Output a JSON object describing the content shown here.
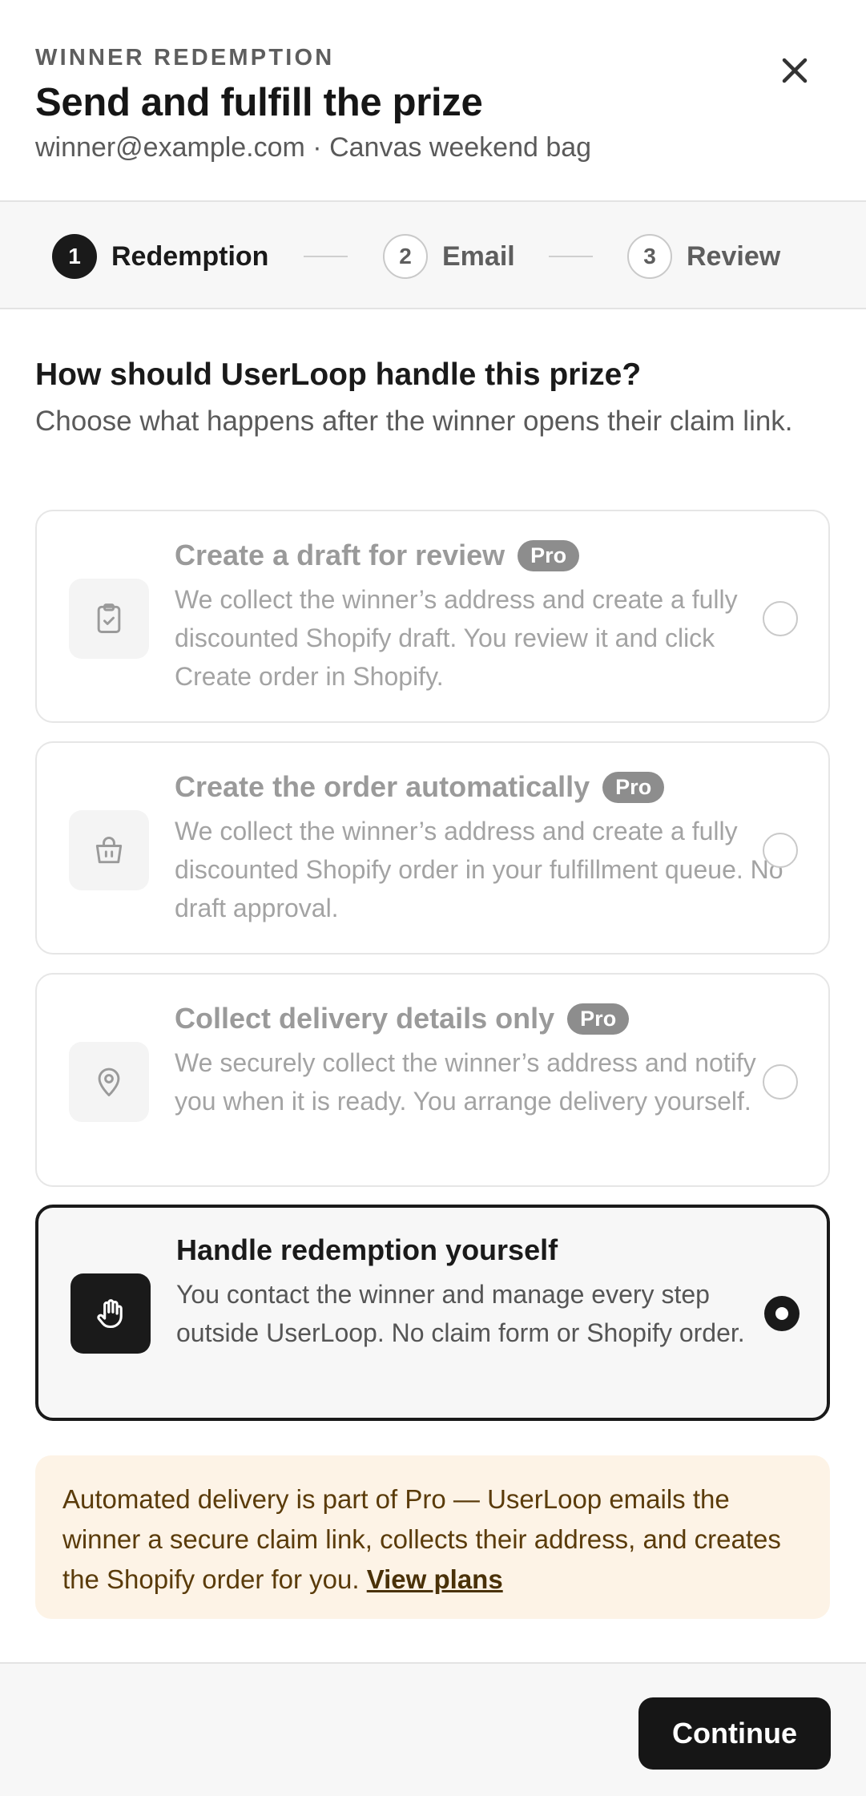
{
  "header": {
    "eyebrow": "WINNER REDEMPTION",
    "title": "Send and fulfill the prize",
    "subtitle": "winner@example.com · Canvas weekend bag",
    "close_icon": "close-icon"
  },
  "stepper": {
    "steps": [
      {
        "number": "1",
        "label": "Redemption",
        "state": "active"
      },
      {
        "number": "2",
        "label": "Email",
        "state": "inactive"
      },
      {
        "number": "3",
        "label": "Review",
        "state": "inactive"
      }
    ]
  },
  "main": {
    "question": "How should UserLoop handle this prize?",
    "question_sub": "Choose what happens after the winner opens their claim link.",
    "options": [
      {
        "title": "Create a draft for review",
        "badge": "Pro",
        "description": "We collect the winner’s address and create a fully discounted Shopify draft. You review it and click Create order in Shopify.",
        "icon": "clipboard-check-icon",
        "selected": false
      },
      {
        "title": "Create the order automatically",
        "badge": "Pro",
        "description": "We collect the winner’s address and create a fully discounted Shopify order in your fulfillment queue. No draft approval.",
        "icon": "shopping-bag-icon",
        "selected": false
      },
      {
        "title": "Collect delivery details only",
        "badge": "Pro",
        "description": "We securely collect the winner’s address and notify you when it is ready. You arrange delivery yourself.",
        "icon": "map-pin-icon",
        "selected": false
      },
      {
        "title": "Handle redemption yourself",
        "description": "You contact the winner and manage every step outside UserLoop. No claim form or Shopify order.",
        "icon": "hand-icon",
        "selected": true
      }
    ],
    "notice": {
      "text": "Automated delivery is part of Pro — UserLoop emails the winner a secure claim link, collects their address, and creates the Shopify order for you.",
      "link": "View plans"
    }
  },
  "footer": {
    "continue_label": "Continue"
  },
  "colors": {
    "primary": "#1a1a1a",
    "muted": "#9a9a9a",
    "notice_bg": "#fdf3e6",
    "pro_badge": "#8d8d8d"
  }
}
